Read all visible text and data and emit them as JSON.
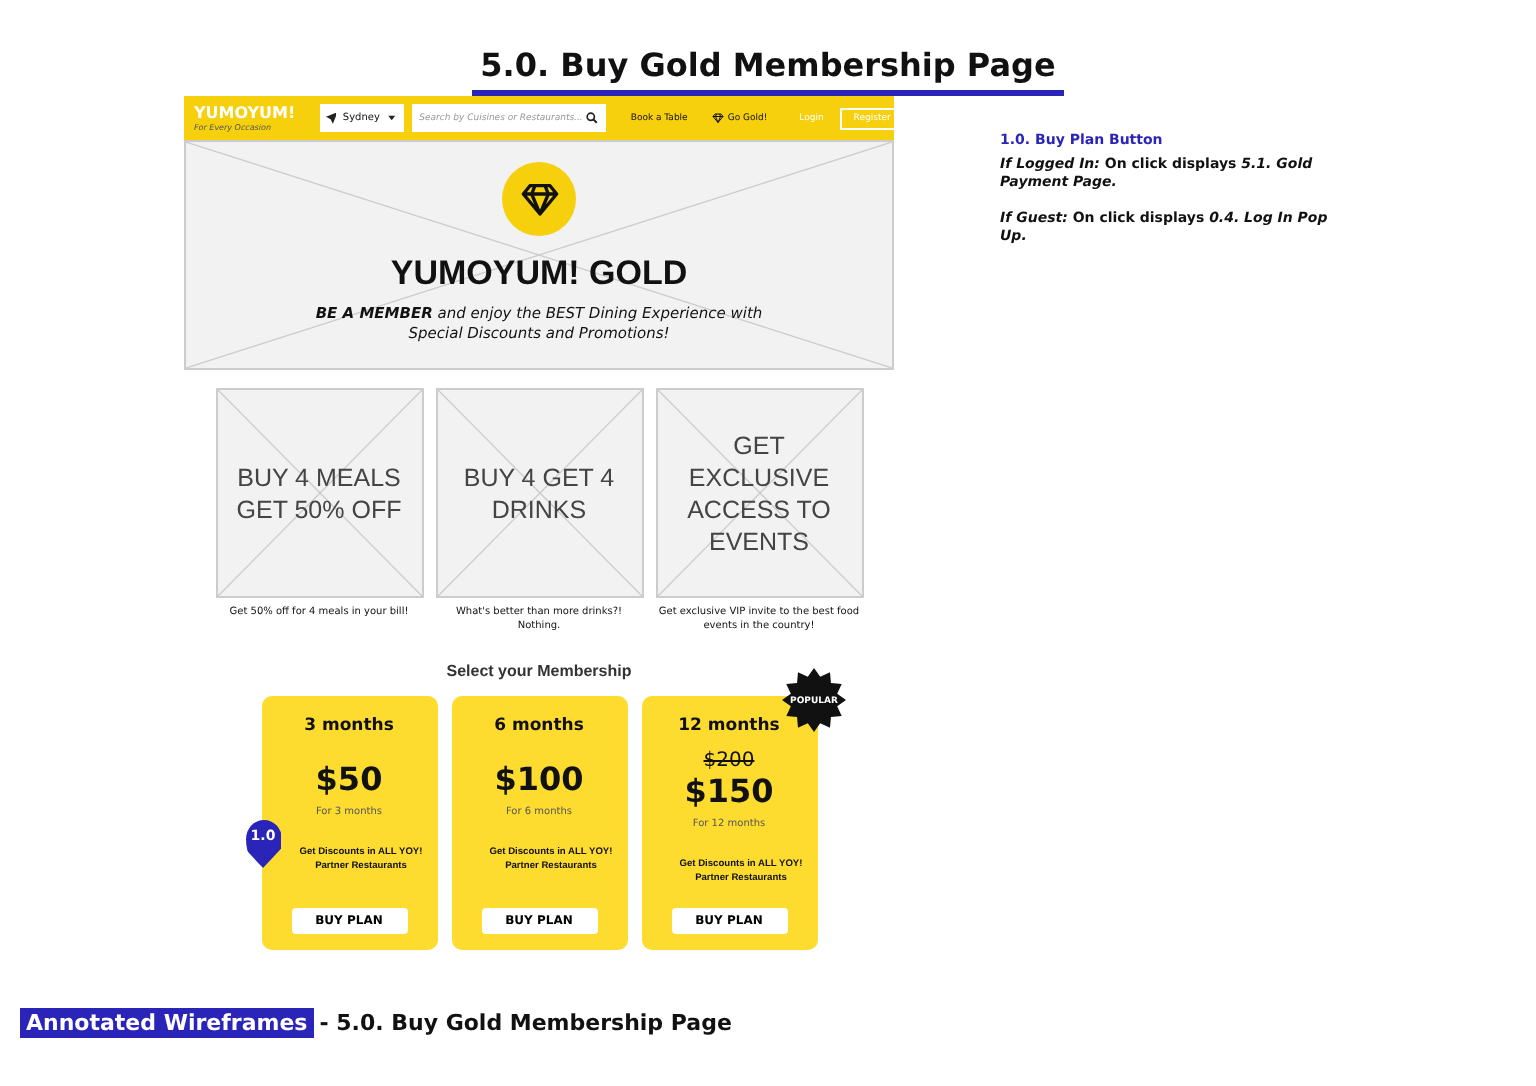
{
  "page_title": "5.0. Buy Gold Membership Page",
  "navbar": {
    "logo": "YUMOYUM!",
    "tagline": "For Every Occasion",
    "location": "Sydney",
    "search": {
      "placeholder": "Search by Cuisines or Restaurants..."
    },
    "links": [
      "Book a Table",
      "Go Gold!",
      "Login"
    ],
    "register": "Register"
  },
  "hero": {
    "title": "YUMOYUM! GOLD",
    "subtitle": "**BE A MEMBER** and enjoy the BEST Dining Experience with Special Discounts and Promotions!"
  },
  "benefits": [
    {
      "headline": "BUY 4 MEALS GET 50% OFF",
      "caption": "Get 50% off for 4 meals in your bill!"
    },
    {
      "headline": "BUY 4 GET 4 DRINKS",
      "caption": "What's better than more drinks?! Nothing."
    },
    {
      "headline": "GET EXCLUSIVE ACCESS TO EVENTS",
      "caption": "Get exclusive VIP invite to the best food events in the country!"
    }
  ],
  "membership": {
    "heading": "Select your Membership",
    "plans": [
      {
        "duration": "3 months",
        "price": "$50",
        "period": "For 3 months",
        "features": "Get Discounts in ALL YOY! Partner Restaurants",
        "button": "BUY PLAN",
        "popular": false,
        "marker": "1.0"
      },
      {
        "duration": "6 months",
        "price": "$100",
        "period": "For 6 months",
        "features": "Get Discounts in ALL YOY! Partner Restaurants",
        "button": "BUY PLAN",
        "popular": false
      },
      {
        "duration": "12 months",
        "old_price": "$200",
        "price": "$150",
        "period": "For 12 months",
        "features": "Get Discounts in ALL YOY! Partner Restaurants",
        "button": "BUY PLAN",
        "popular": true,
        "badge": "POPULAR"
      }
    ]
  },
  "annotations": [
    {
      "title": "1.0. Buy Plan Button",
      "notes": [
        "*If Logged In:* On click displays *5.1. Gold Payment Page.*",
        "*If Guest:* On click displays *0.4. Log In Pop Up.*"
      ]
    }
  ],
  "footer": {
    "tag": "Annotated Wireframes",
    "text": "- 5.0. Buy Gold Membership Page"
  }
}
